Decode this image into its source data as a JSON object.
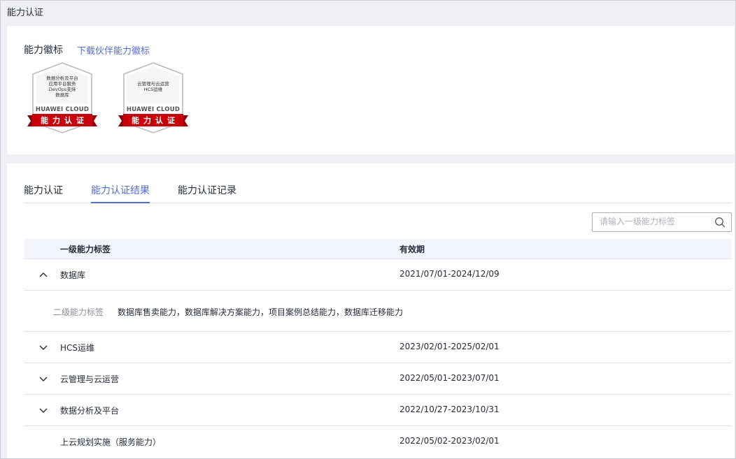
{
  "page": {
    "title": "能力认证"
  },
  "badges_section": {
    "heading": "能力徽标",
    "download_link": "下载伙伴能力徽标",
    "badges": [
      {
        "lines": [
          "数据分析及平台",
          "应用平台服务",
          "DevOps支持",
          "数据库"
        ],
        "brand": "HUAWEI CLOUD",
        "ribbon": "能力认证"
      },
      {
        "lines": [
          "云管理与云运营",
          "HCS运维"
        ],
        "brand": "HUAWEI CLOUD",
        "ribbon": "能力认证"
      }
    ]
  },
  "tabs": [
    {
      "label": "能力认证",
      "active": false
    },
    {
      "label": "能力认证结果",
      "active": true
    },
    {
      "label": "能力认证记录",
      "active": false
    }
  ],
  "search": {
    "placeholder": "请输入一级能力标签",
    "value": ""
  },
  "table": {
    "columns": [
      "一级能力标签",
      "有效期"
    ],
    "rows": [
      {
        "label": "数据库",
        "period": "2021/07/01-2024/12/09",
        "expanded": true,
        "detail_label": "二级能力标签",
        "detail_value": "数据库售卖能力，数据库解决方案能力，项目案例总结能力，数据库迁移能力"
      },
      {
        "label": "HCS运维",
        "period": "2023/02/01-2025/02/01",
        "expanded": false
      },
      {
        "label": "云管理与云运营",
        "period": "2022/05/01-2023/07/01",
        "expanded": false
      },
      {
        "label": "数据分析及平台",
        "period": "2022/10/27-2023/10/31",
        "expanded": false
      },
      {
        "label": "上云规划实施（服务能力）",
        "period": "2022/05/02-2023/02/01",
        "expanded": null
      }
    ]
  },
  "colors": {
    "accent": "#526ecc",
    "ribbon": "#c7000b",
    "text": "#252b3a",
    "muted": "#8a8e99"
  }
}
